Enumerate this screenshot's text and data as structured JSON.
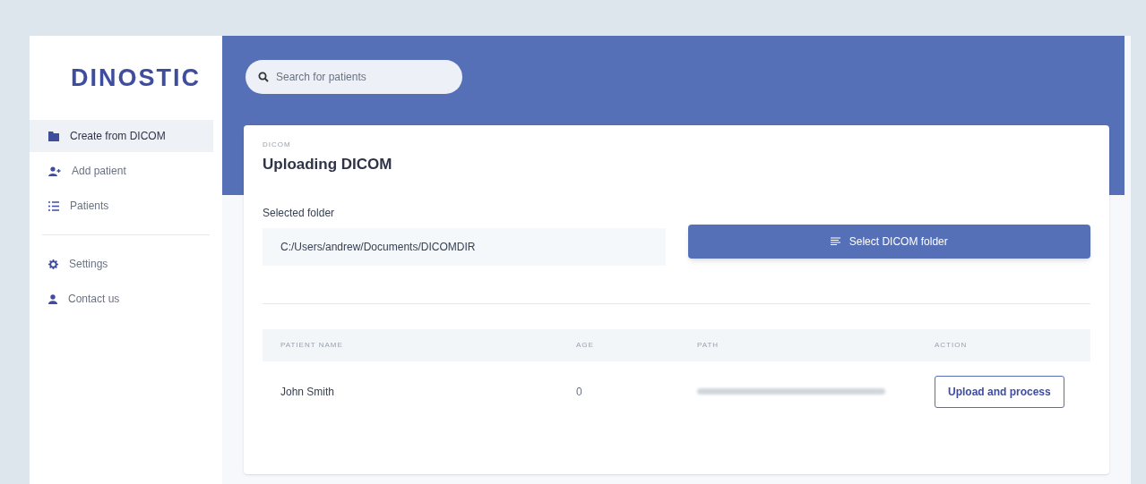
{
  "logo": "DINOSTIC",
  "sidebar": {
    "items": [
      {
        "label": "Create from DICOM",
        "kind": "folder",
        "selected": true
      },
      {
        "label": "Add patient",
        "kind": "user-plus",
        "selected": false
      },
      {
        "label": "Patients",
        "kind": "list",
        "selected": false
      }
    ],
    "secondary_items": [
      {
        "label": "Settings",
        "kind": "gear",
        "selected": false
      },
      {
        "label": "Contact us",
        "kind": "user",
        "selected": false
      }
    ]
  },
  "search": {
    "placeholder": "Search for patients"
  },
  "card": {
    "overline": "DICOM",
    "title": "Uploading DICOM",
    "folder_label": "Selected folder",
    "folder_value": "C:/Users/andrew/Documents/DICOMDIR",
    "select_button": "Select DICOM folder"
  },
  "table": {
    "columns": [
      "PATIENT NAME",
      "AGE",
      "PATH",
      "ACTION"
    ],
    "rows": [
      {
        "name": "John Smith",
        "age": "0",
        "path_redacted": true,
        "action": "Upload and process"
      }
    ]
  }
}
